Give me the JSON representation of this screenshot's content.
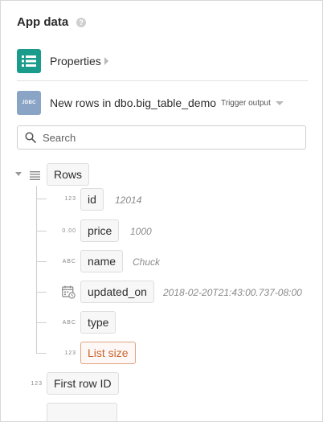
{
  "header": {
    "title": "App data",
    "help_icon": "help-circle-icon"
  },
  "properties": {
    "label": "Properties",
    "icon": "list-table-icon",
    "icon_color": "#1a9b8c"
  },
  "trigger": {
    "icon_text": "JDBC",
    "icon_color": "#8aa4c6",
    "label": "New rows in dbo.big_table_demo",
    "tag": "Trigger output"
  },
  "search": {
    "placeholder": "Search",
    "value": ""
  },
  "tree": {
    "root": {
      "label": "Rows"
    },
    "fields": [
      {
        "type": "123",
        "name": "id",
        "sample": "12014"
      },
      {
        "type": "0.00",
        "name": "price",
        "sample": "1000"
      },
      {
        "type": "ABC",
        "name": "name",
        "sample": "Chuck"
      },
      {
        "type": "calendar-icon",
        "name": "updated_on",
        "sample": "2018-02-20T21:43:00.737-08:00"
      },
      {
        "type": "ABC",
        "name": "type",
        "sample": ""
      },
      {
        "type": "123",
        "name": "List size",
        "sample": ""
      }
    ],
    "after": [
      {
        "type": "123",
        "name": "First row ID"
      }
    ]
  },
  "colors": {
    "highlight": "#c9632d",
    "accent": "#1a9b8c"
  }
}
